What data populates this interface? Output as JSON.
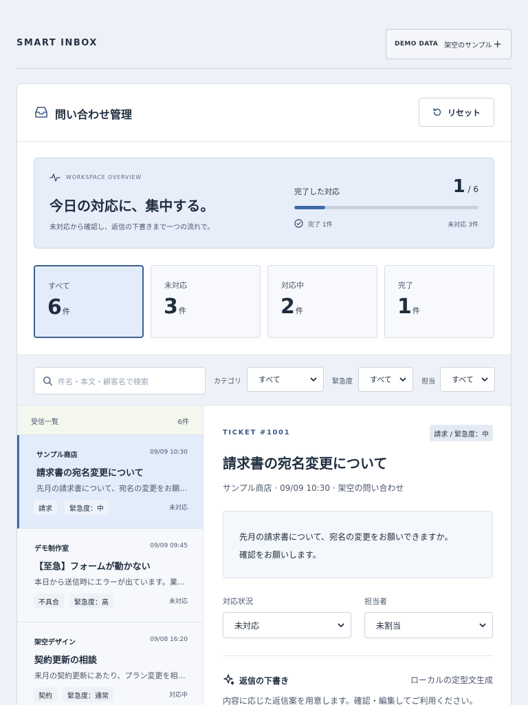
{
  "header": {
    "brand": "SMART INBOX",
    "demo_tag": "DEMO DATA",
    "demo_sub": "架空のサンプル",
    "demo_plus": "+"
  },
  "card": {
    "title": "問い合わせ管理",
    "reset_label": "リセット"
  },
  "overview": {
    "eyebrow": "WORKSPACE OVERVIEW",
    "title": "今日の対応に、集中する。",
    "desc": "未対応から確認し、返信の下書きまで一つの流れで。",
    "done_label": "完了した対応",
    "done_count": "1",
    "total_text": " / 6",
    "progress": 0.1667,
    "done_small": "完了 1件",
    "pending_small": "未対応 3件"
  },
  "stats": [
    {
      "label": "すべて",
      "value": "6",
      "unit": "件"
    },
    {
      "label": "未対応",
      "value": "3",
      "unit": "件"
    },
    {
      "label": "対応中",
      "value": "2",
      "unit": "件"
    },
    {
      "label": "完了",
      "value": "1",
      "unit": "件"
    }
  ],
  "filters": {
    "search_placeholder": "件名・本文・顧客名で検索",
    "category_label": "カテゴリ",
    "category_value": "すべて",
    "urgency_label": "緊急度",
    "urgency_value": "すべて",
    "assignee_label": "担当",
    "assignee_value": "すべて"
  },
  "list": {
    "title": "受信一覧",
    "count": "6件",
    "items": [
      {
        "shop": "サンプル商店",
        "time": "09/09 10:30",
        "subject": "請求書の宛名変更について",
        "snippet": "先月の請求書について、宛名の変更をお願いできますか。",
        "category": "請求",
        "urgency": "緊急度：中",
        "status": "未対応"
      },
      {
        "shop": "デモ制作室",
        "time": "09/09 09:45",
        "subject": "【至急】フォームが動かない",
        "snippet": "本日から送信時にエラーが出ています。業務に影響が出ています。",
        "category": "不具合",
        "urgency": "緊急度：高",
        "status": "未対応"
      },
      {
        "shop": "架空デザイン",
        "time": "09/08 16:20",
        "subject": "契約更新の相談",
        "snippet": "来月の契約更新にあたり、プラン変更を相談したいです。",
        "category": "契約",
        "urgency": "緊急度：通常",
        "status": "対応中"
      }
    ]
  },
  "detail": {
    "ticket": "TICKET #1001",
    "badge": "請求 / 緊急度：中",
    "subject": "請求書の宛名変更について",
    "meta": "サンプル商店 · 09/09 10:30 · 架空の問い合わせ",
    "body_line1": "先月の請求書について、宛名の変更をお願いできますか。",
    "body_line2": "確認をお願いします。",
    "status_label": "対応状況",
    "status_value": "未対応",
    "assignee_label": "担当者",
    "assignee_value": "未割当",
    "reply_title": "返信の下書き",
    "reply_gen": "ローカルの定型文生成",
    "reply_desc": "内容に応じた返信案を用意します。確認・編集してご利用ください。"
  },
  "colors": {
    "accent": "#3e6aa8",
    "background": "#eef2f8",
    "card": "#ffffff",
    "selected": "#e3ecfb"
  }
}
